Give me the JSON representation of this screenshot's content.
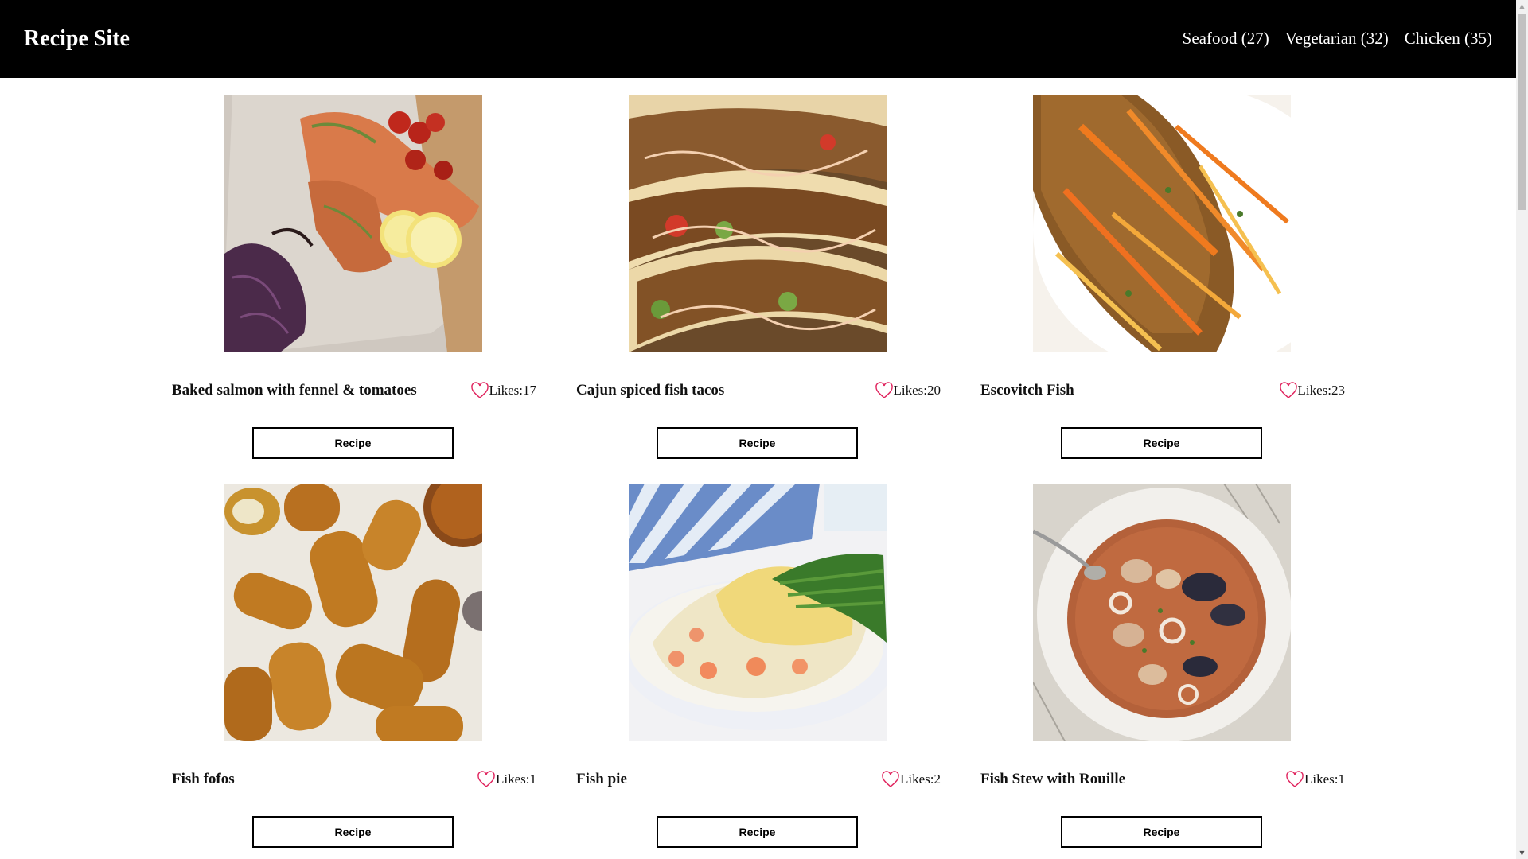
{
  "brand": "Recipe Site",
  "nav": [
    {
      "label": "Seafood (27)"
    },
    {
      "label": "Vegetarian (32)"
    },
    {
      "label": "Chicken (35)"
    }
  ],
  "recipes": [
    {
      "title": "Baked salmon with fennel & tomatoes",
      "likes": "Likes:17",
      "button": "Recipe"
    },
    {
      "title": "Cajun spiced fish tacos",
      "likes": "Likes:20",
      "button": "Recipe"
    },
    {
      "title": "Escovitch Fish",
      "likes": "Likes:23",
      "button": "Recipe"
    },
    {
      "title": "Fish fofos",
      "likes": "Likes:1",
      "button": "Recipe"
    },
    {
      "title": "Fish pie",
      "likes": "Likes:2",
      "button": "Recipe"
    },
    {
      "title": "Fish Stew with Rouille",
      "likes": "Likes:1",
      "button": "Recipe"
    }
  ],
  "colors": {
    "navbar": "#000000",
    "heart": "#e0245e"
  }
}
